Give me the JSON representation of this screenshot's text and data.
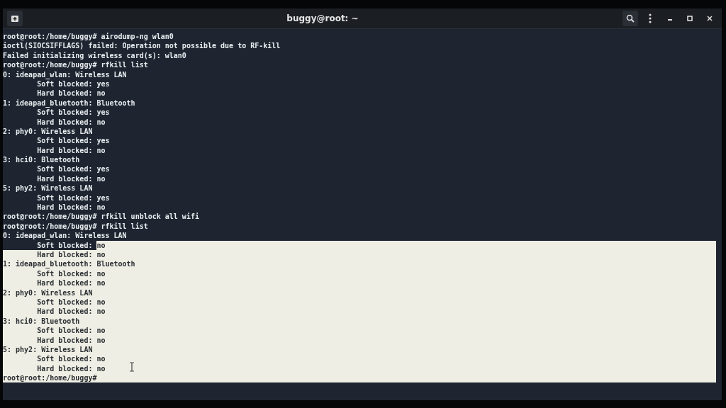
{
  "window": {
    "title": "buggy@root: ~"
  },
  "terminal": {
    "lines": [
      {
        "text": "root@root:/home/buggy# airodump-ng wlan0",
        "selected": false
      },
      {
        "text": "ioctl(SIOCSIFFLAGS) failed: Operation not possible due to RF-kill",
        "selected": false
      },
      {
        "text": "Failed initializing wireless card(s): wlan0",
        "selected": false
      },
      {
        "text": "root@root:/home/buggy# rfkill list",
        "selected": false
      },
      {
        "text": "0: ideapad_wlan: Wireless LAN",
        "selected": false
      },
      {
        "text": "        Soft blocked: yes",
        "selected": false
      },
      {
        "text": "        Hard blocked: no",
        "selected": false
      },
      {
        "text": "1: ideapad_bluetooth: Bluetooth",
        "selected": false
      },
      {
        "text": "        Soft blocked: yes",
        "selected": false
      },
      {
        "text": "        Hard blocked: no",
        "selected": false
      },
      {
        "text": "2: phy0: Wireless LAN",
        "selected": false
      },
      {
        "text": "        Soft blocked: yes",
        "selected": false
      },
      {
        "text": "        Hard blocked: no",
        "selected": false
      },
      {
        "text": "3: hci0: Bluetooth",
        "selected": false
      },
      {
        "text": "        Soft blocked: yes",
        "selected": false
      },
      {
        "text": "        Hard blocked: no",
        "selected": false
      },
      {
        "text": "5: phy2: Wireless LAN",
        "selected": false
      },
      {
        "text": "        Soft blocked: yes",
        "selected": false
      },
      {
        "text": "        Hard blocked: no",
        "selected": false
      },
      {
        "text": "root@root:/home/buggy# rfkill unblock all wifi",
        "selected": false
      },
      {
        "text": "root@root:/home/buggy# rfkill list",
        "selected": false
      },
      {
        "text": "0: ideapad_wlan: Wireless LAN",
        "selected": false
      },
      {
        "text": "        Soft blocked: ",
        "selected": false,
        "tail": "no"
      },
      {
        "text": "        Hard blocked: no",
        "selected": true
      },
      {
        "text": "1: ideapad_bluetooth: Bluetooth",
        "selected": true
      },
      {
        "text": "        Soft blocked: no",
        "selected": true
      },
      {
        "text": "        Hard blocked: no",
        "selected": true
      },
      {
        "text": "2: phy0: Wireless LAN",
        "selected": true
      },
      {
        "text": "        Soft blocked: no",
        "selected": true
      },
      {
        "text": "        Hard blocked: no",
        "selected": true
      },
      {
        "text": "3: hci0: Bluetooth",
        "selected": true
      },
      {
        "text": "        Soft blocked: no",
        "selected": true
      },
      {
        "text": "        Hard blocked: no",
        "selected": true
      },
      {
        "text": "5: phy2: Wireless LAN",
        "selected": true
      },
      {
        "text": "        Soft blocked: no",
        "selected": true
      },
      {
        "text": "        Hard blocked: no",
        "selected": true
      },
      {
        "text": "root@root:/home/buggy#",
        "selected": true
      }
    ]
  }
}
